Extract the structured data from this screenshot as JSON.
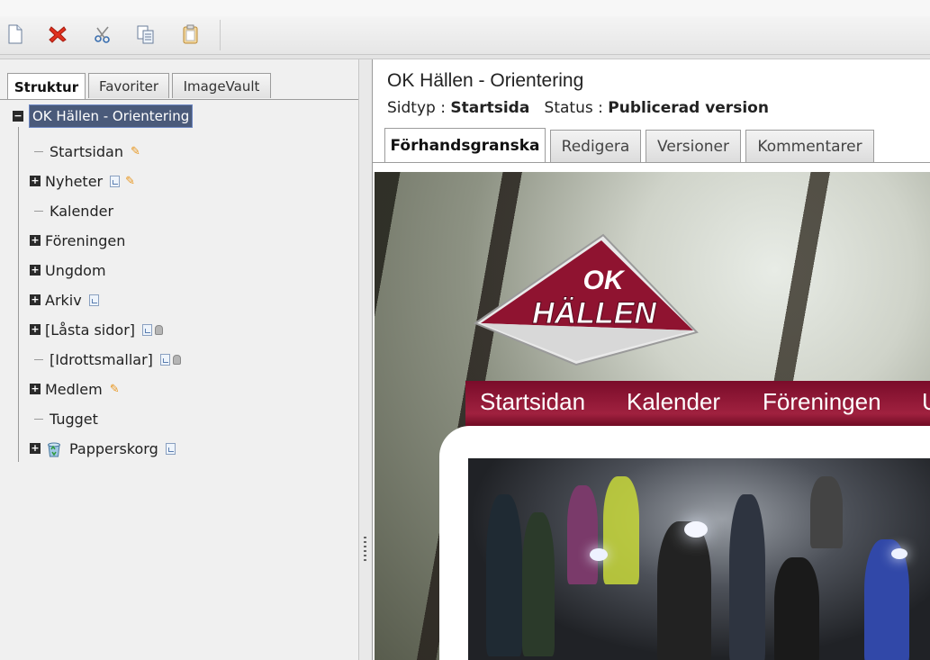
{
  "toolbar": {
    "buttons": [
      {
        "name": "new-page-icon"
      },
      {
        "name": "delete-icon"
      },
      {
        "name": "cut-icon"
      },
      {
        "name": "copy-icon"
      },
      {
        "name": "paste-icon"
      }
    ]
  },
  "left_panel": {
    "tabs": [
      {
        "label": "Struktur",
        "active": true
      },
      {
        "label": "Favoriter",
        "active": false
      },
      {
        "label": "ImageVault",
        "active": false
      }
    ],
    "tree": {
      "root": "OK Hällen - Orientering",
      "items": [
        {
          "label": "Startsidan",
          "expandable": false,
          "icons": [
            "pencil-icon"
          ]
        },
        {
          "label": "Nyheter",
          "expandable": true,
          "icons": [
            "page-icon",
            "pencil-icon"
          ]
        },
        {
          "label": "Kalender",
          "expandable": false,
          "icons": []
        },
        {
          "label": "Föreningen",
          "expandable": true,
          "icons": []
        },
        {
          "label": "Ungdom",
          "expandable": true,
          "icons": []
        },
        {
          "label": "Arkiv",
          "expandable": true,
          "icons": [
            "page-icon"
          ]
        },
        {
          "label": "[Låsta sidor]",
          "expandable": true,
          "icons": [
            "page-icon",
            "lock-icon"
          ]
        },
        {
          "label": "[Idrottsmallar]",
          "expandable": false,
          "icons": [
            "page-icon",
            "lock-icon"
          ]
        },
        {
          "label": "Medlem",
          "expandable": true,
          "icons": [
            "pencil-icon"
          ]
        },
        {
          "label": "Tugget",
          "expandable": false,
          "icons": []
        },
        {
          "label": "Papperskorg",
          "expandable": true,
          "icons": [
            "recycle-bin-icon",
            "page-icon"
          ]
        }
      ]
    }
  },
  "right_panel": {
    "title": "OK Hällen - Orientering",
    "meta": {
      "pagetype_label": "Sidtyp",
      "pagetype_value": "Startsida",
      "status_label": "Status",
      "status_value": "Publicerad version",
      "separator": ":"
    },
    "tabs": [
      {
        "label": "Förhandsgranska",
        "active": true
      },
      {
        "label": "Redigera",
        "active": false
      },
      {
        "label": "Versioner",
        "active": false
      },
      {
        "label": "Kommentarer",
        "active": false
      }
    ],
    "preview": {
      "logo_text_1": "OK",
      "logo_text_2": "HÄLLEN",
      "nav": [
        "Startsidan",
        "Kalender",
        "Föreningen",
        "U"
      ],
      "nav_color": "#8b1434"
    }
  }
}
